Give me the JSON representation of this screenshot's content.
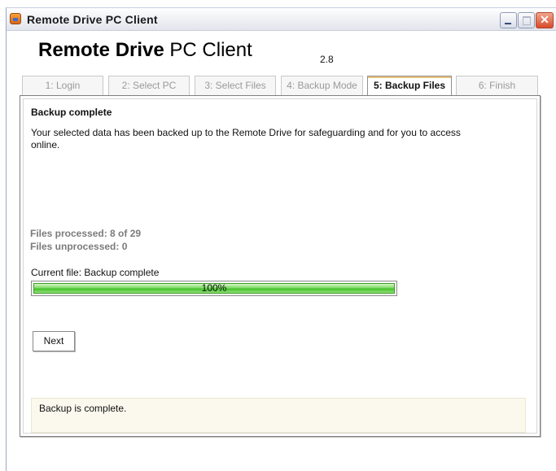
{
  "window": {
    "title": "Remote Drive PC Client",
    "minimize": "",
    "maximize": "",
    "close": "✕"
  },
  "brand": {
    "name_bold": "Remote Drive",
    "name_regular": " PC Client",
    "version": "2.8"
  },
  "tabs": [
    {
      "label": "1: Login",
      "active": false
    },
    {
      "label": "2: Select PC",
      "active": false
    },
    {
      "label": "3: Select Files",
      "active": false
    },
    {
      "label": "4: Backup Mode",
      "active": false
    },
    {
      "label": "5: Backup Files",
      "active": true
    },
    {
      "label": "6: Finish",
      "active": false
    }
  ],
  "main": {
    "heading": "Backup complete",
    "description": "Your selected data has been backed up to the Remote Drive for safeguarding and for you to access online.",
    "files_processed": "Files processed: 8 of 29",
    "files_unprocessed": "Files unprocessed: 0",
    "current_file": "Current file: Backup complete",
    "progress": {
      "value": 100,
      "label": "100%"
    },
    "next_button": "Next",
    "status_message": "Backup is complete."
  }
}
